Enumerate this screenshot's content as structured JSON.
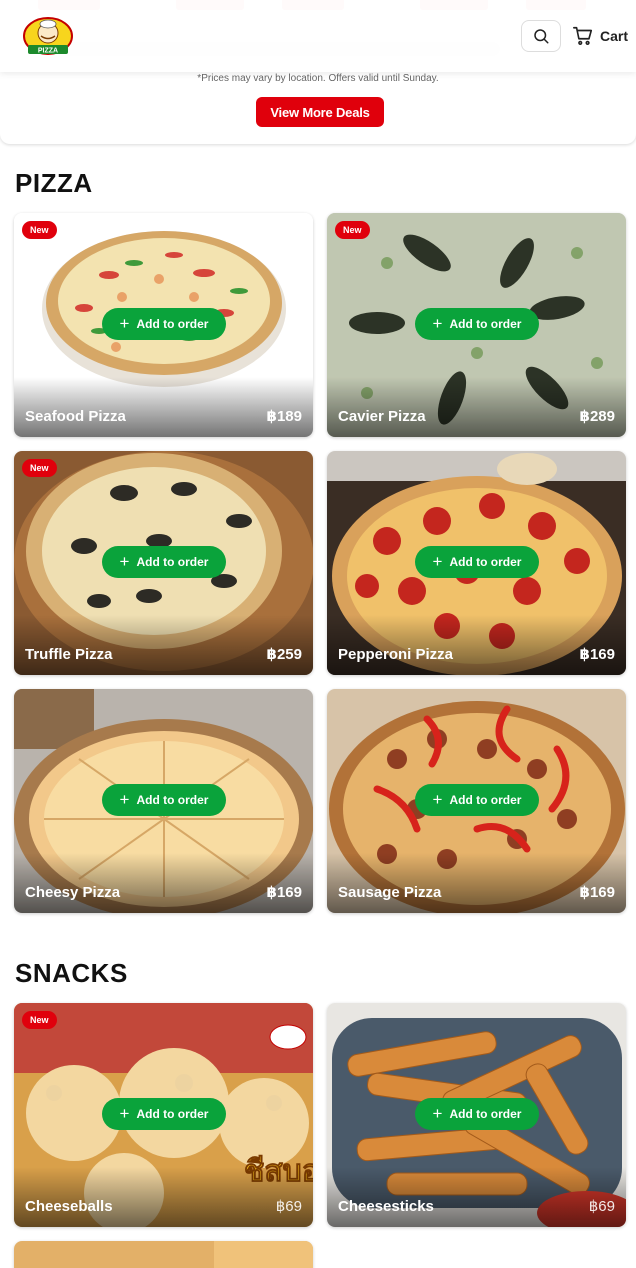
{
  "header": {
    "logo_text": "PIZZA",
    "cart_label": "Cart"
  },
  "deals": {
    "note": "*Prices may vary by location. Offers valid until Sunday.",
    "button_label": "View More Deals"
  },
  "sections": [
    {
      "title": "PIZZA",
      "items": [
        {
          "name": "Seafood Pizza",
          "price": "฿189",
          "badge": "New",
          "action": "Add to order"
        },
        {
          "name": "Cavier Pizza",
          "price": "฿289",
          "badge": "New",
          "action": "Add to order"
        },
        {
          "name": "Truffle Pizza",
          "price": "฿259",
          "badge": "New",
          "action": "Add to order"
        },
        {
          "name": "Pepperoni Pizza",
          "price": "฿169",
          "badge": "",
          "action": "Add to order"
        },
        {
          "name": "Cheesy Pizza",
          "price": "฿169",
          "badge": "",
          "action": "Add to order"
        },
        {
          "name": "Sausage Pizza",
          "price": "฿169",
          "badge": "",
          "action": "Add to order"
        }
      ]
    },
    {
      "title": "SNACKS",
      "items": [
        {
          "name": "Cheeseballs",
          "price": "฿69",
          "badge": "New",
          "action": "Add to order",
          "image_overlay_text": "ชีสบอล ทอง"
        },
        {
          "name": "Cheesesticks",
          "price": "฿69",
          "badge": "",
          "action": "Add to order"
        }
      ]
    }
  ],
  "colors": {
    "brand_red": "#e0000c",
    "add_green": "#0aa33b"
  },
  "icons": [
    "search-icon",
    "cart-icon",
    "plus-icon"
  ]
}
